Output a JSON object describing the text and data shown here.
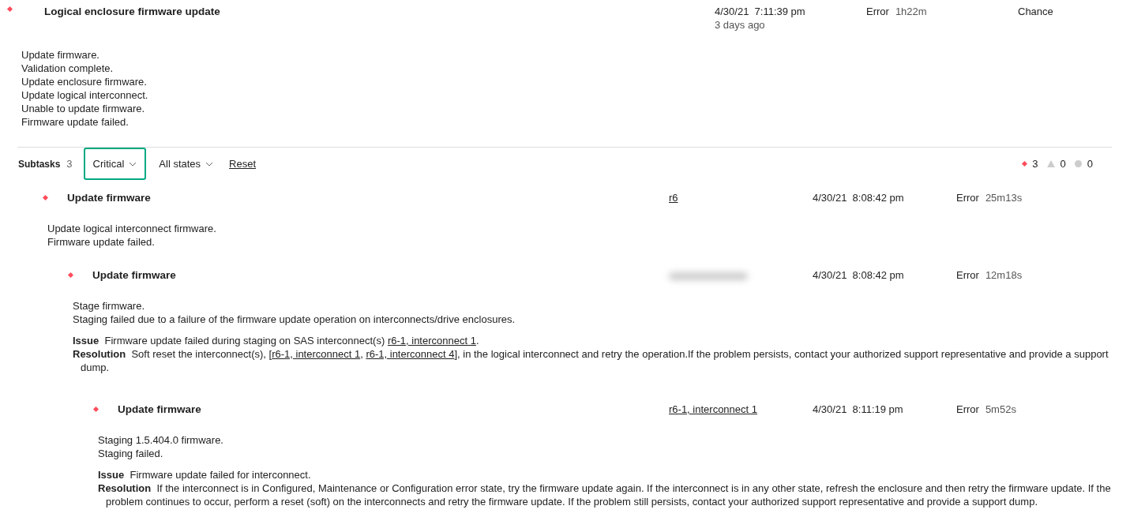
{
  "task": {
    "kind": "critical",
    "title": "Logical enclosure firmware update",
    "date": "4/30/21  7:11:39 pm",
    "age": "3 days ago",
    "state": "Error",
    "duration": "1h22m",
    "owner": "Chance",
    "messages": [
      "Update firmware.",
      "Validation complete.",
      "Update enclosure firmware.",
      "Update logical interconnect.",
      "Unable to update firmware.",
      "Firmware update failed."
    ]
  },
  "subtasks_bar": {
    "label": "Subtasks",
    "count": "3",
    "filters": [
      {
        "label": "Critical",
        "focused": true
      },
      {
        "label": "All states",
        "focused": false
      }
    ],
    "reset": "Reset",
    "counts": [
      {
        "kind": "critical",
        "count": "3"
      },
      {
        "kind": "warning",
        "count": "0"
      },
      {
        "kind": "ok",
        "count": "0"
      }
    ]
  },
  "subtasks": [
    {
      "kind": "critical",
      "title": "Update firmware",
      "resource": "r6",
      "date": "4/30/21  8:08:42 pm",
      "state": "Error",
      "duration": "25m13s",
      "messages": [
        "Update logical interconnect firmware.",
        "Firmware update failed."
      ],
      "children": [
        {
          "kind": "critical",
          "title": "Update firmware",
          "date": "4/30/21  8:08:42 pm",
          "state": "Error",
          "duration": "12m18s",
          "messages": [
            "Stage firmware.",
            "Staging failed due to a failure of the firmware update operation on interconnects/drive enclosures."
          ],
          "issue": {
            "label": "Issue",
            "parts": [
              {
                "text": "Firmware update failed during staging on SAS interconnect(s) ",
                "link": false
              },
              {
                "text": "r6-1, interconnect 1",
                "link": true
              },
              {
                "text": ".",
                "link": false
              }
            ]
          },
          "resolution": {
            "label": "Resolution",
            "parts": [
              {
                "text": "Soft reset the interconnect(s), [",
                "link": false
              },
              {
                "text": "r6-1, interconnect 1",
                "link": true
              },
              {
                "text": ", ",
                "link": false
              },
              {
                "text": "r6-1, interconnect 4",
                "link": true
              },
              {
                "text": "], in the logical interconnect and retry the operation.If the problem persists, contact your authorized support representative and provide a support dump.",
                "link": false
              }
            ]
          },
          "children": [
            {
              "kind": "critical",
              "title": "Update firmware",
              "resource": "r6-1, interconnect 1",
              "date": "4/30/21  8:11:19 pm",
              "state": "Error",
              "duration": "5m52s",
              "messages": [
                "Staging 1.5.404.0 firmware.",
                "Staging failed."
              ],
              "issue": {
                "label": "Issue",
                "parts": [
                  {
                    "text": "Firmware update failed for interconnect.",
                    "link": false
                  }
                ]
              },
              "resolution": {
                "label": "Resolution",
                "parts": [
                  {
                    "text": "If the interconnect is in Configured, Maintenance or Configuration error state, try the firmware update again. If the interconnect is in any other state, refresh the enclosure and then retry the firmware update. If the problem continues to occur, perform a reset (soft) on the interconnects and retry the firmware update. If the problem still persists, contact your authorized support representative and provide a support dump.",
                    "link": false
                  }
                ]
              }
            }
          ]
        }
      ]
    }
  ]
}
